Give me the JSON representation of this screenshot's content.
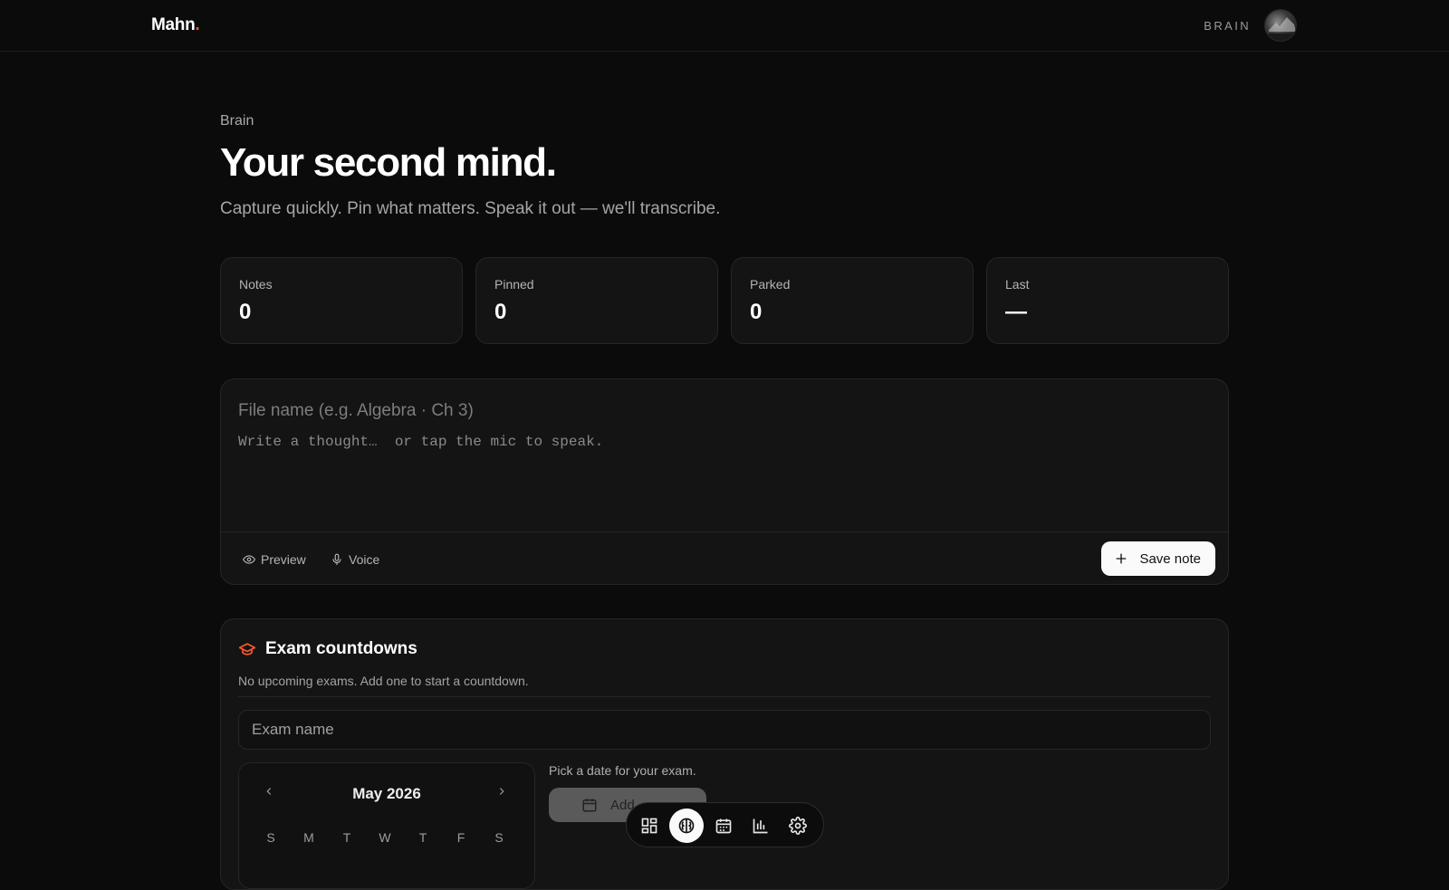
{
  "app": {
    "logo_text": "Mahn",
    "logo_dot": ".",
    "section_label": "BRAIN",
    "accent": "#ff5a2c"
  },
  "header": {
    "eyebrow": "Brain",
    "title": "Your second mind.",
    "subtitle": "Capture quickly. Pin what matters. Speak it out — we'll transcribe."
  },
  "stats": [
    {
      "label": "Notes",
      "value": "0"
    },
    {
      "label": "Pinned",
      "value": "0"
    },
    {
      "label": "Parked",
      "value": "0"
    },
    {
      "label": "Last",
      "value": "—"
    }
  ],
  "composer": {
    "file_placeholder": "File name (e.g. Algebra · Ch 3)",
    "body_placeholder": "Write a thought…  or tap the mic to speak.",
    "preview_label": "Preview",
    "voice_label": "Voice",
    "save_label": "Save note"
  },
  "exams": {
    "title": "Exam countdowns",
    "empty_text": "No upcoming exams. Add one to start a countdown.",
    "name_placeholder": "Exam name",
    "pick_text": "Pick a date for your exam.",
    "add_label": "Add",
    "calendar": {
      "month": "May 2026",
      "weekdays": [
        "S",
        "M",
        "T",
        "W",
        "T",
        "F",
        "S"
      ]
    }
  },
  "dock": {
    "items": [
      {
        "icon": "grid-icon",
        "active": false
      },
      {
        "icon": "brain-icon",
        "active": true
      },
      {
        "icon": "calendar-icon",
        "active": false
      },
      {
        "icon": "bar-chart-icon",
        "active": false
      },
      {
        "icon": "gear-icon",
        "active": false
      }
    ]
  }
}
